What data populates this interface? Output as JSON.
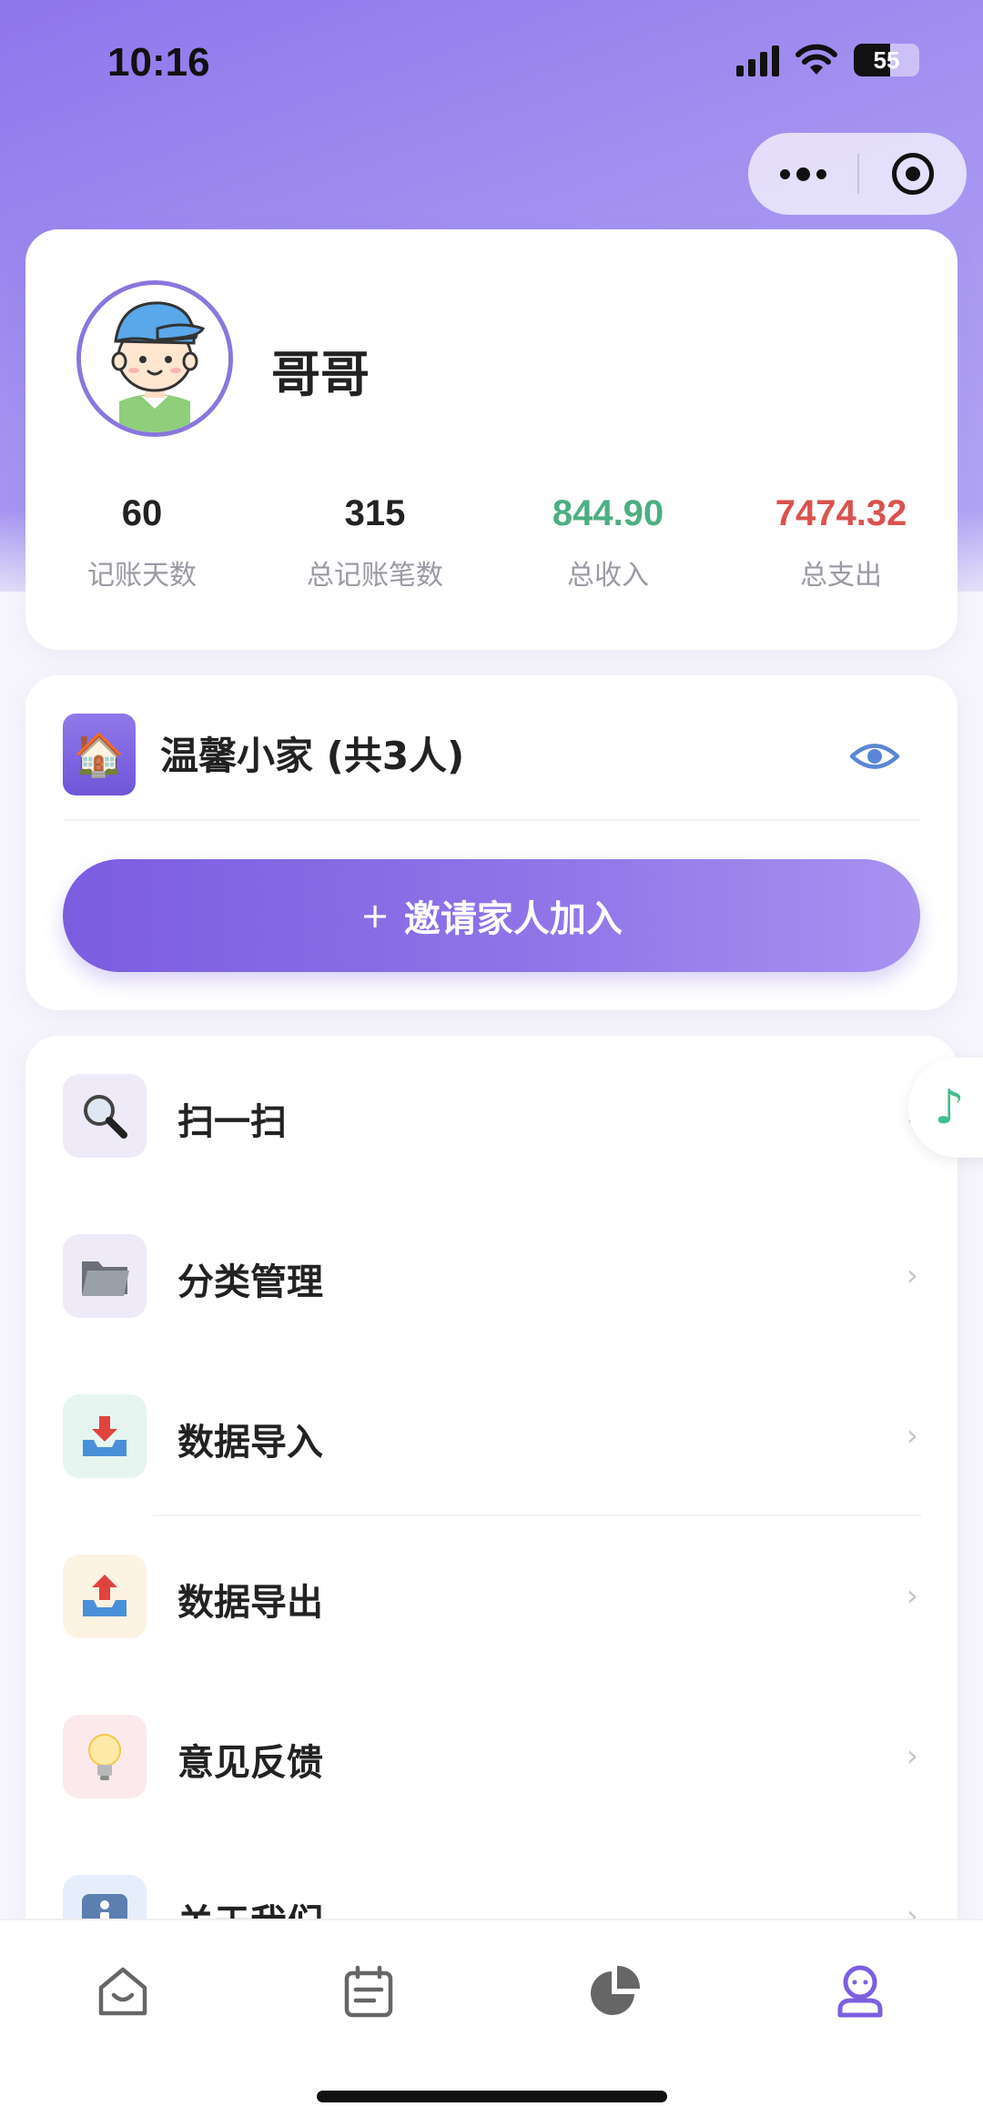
{
  "status_bar": {
    "time": "10:16",
    "battery": "55"
  },
  "capsule": {
    "more_icon": "more-dots-icon",
    "close_icon": "target-circle-icon"
  },
  "profile": {
    "username": "哥哥",
    "avatar_icon": "boy-cap-avatar",
    "stats": [
      {
        "value": "60",
        "label": "记账天数"
      },
      {
        "value": "315",
        "label": "总记账笔数"
      },
      {
        "value": "844.90",
        "label": "总收入"
      },
      {
        "value": "7474.32",
        "label": "总支出"
      }
    ],
    "colors": {
      "income": "#4caf82",
      "expense": "#d9534f"
    }
  },
  "family": {
    "icon": "house-emoji",
    "name": "温馨小家 (共3人)",
    "eye_icon": "eye-icon",
    "invite_plus": "+",
    "invite_label": "邀请家人加入"
  },
  "menu": {
    "items": [
      {
        "label": "扫一扫",
        "icon": "magnifier-icon",
        "bg": "#eeeaf8"
      },
      {
        "label": "分类管理",
        "icon": "folder-icon",
        "bg": "#eeeaf8"
      },
      {
        "label": "数据导入",
        "icon": "inbox-download-icon",
        "bg": "#e6f5ef"
      },
      {
        "label": "数据导出",
        "icon": "inbox-upload-icon",
        "bg": "#fdf3e3"
      },
      {
        "label": "意见反馈",
        "icon": "lightbulb-icon",
        "bg": "#fbe9ec"
      },
      {
        "label": "关于我们",
        "icon": "info-icon",
        "bg": "#e6eefb"
      }
    ],
    "chevron": "›"
  },
  "floating": {
    "icon": "music-note-icon",
    "glyph": "♪"
  },
  "tabbar": {
    "active_color": "#7c5fe0",
    "inactive_color": "#666666",
    "tabs": [
      {
        "icon": "home-icon",
        "active": false
      },
      {
        "icon": "list-note-icon",
        "active": false
      },
      {
        "icon": "pie-chart-icon",
        "active": false
      },
      {
        "icon": "profile-icon",
        "active": true
      }
    ]
  }
}
